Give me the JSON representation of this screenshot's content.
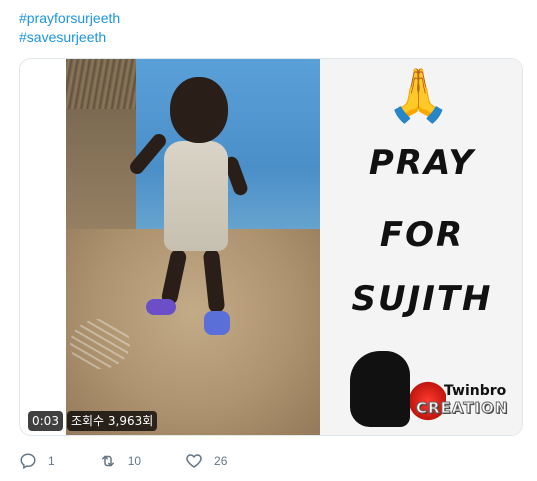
{
  "hashtags": [
    "#prayforsurjeeth",
    "#savesurjeeth"
  ],
  "media": {
    "overlay_text": {
      "line1": "PRAY",
      "line2": "FOR",
      "line3": "SUJITH"
    },
    "emoji": "🙏",
    "logo": {
      "name": "Twinbro",
      "subtitle": "CREATION"
    },
    "video_time": "0:03",
    "views": "조회수 3,963회"
  },
  "actions": {
    "reply": {
      "icon": "reply-icon",
      "count": "1"
    },
    "retweet": {
      "icon": "retweet-icon",
      "count": "10"
    },
    "like": {
      "icon": "heart-icon",
      "count": "26"
    }
  },
  "colors": {
    "link": "#1b95e0",
    "action": "#657786",
    "border": "#e1e8ed"
  }
}
